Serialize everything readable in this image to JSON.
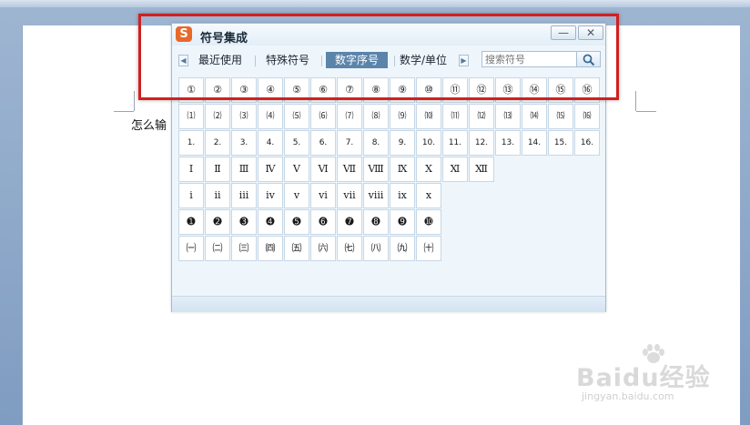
{
  "document": {
    "body_text": "怎么输"
  },
  "symbol_window": {
    "logo": "S",
    "title": "符号集成",
    "minimize_label": "—",
    "close_label": "✕",
    "tabs": [
      {
        "label": "最近使用"
      },
      {
        "label": "特殊符号"
      },
      {
        "label": "数字序号",
        "active": true
      },
      {
        "label": "数学/单位"
      }
    ],
    "prev_label": "◀",
    "next_label": "▶",
    "search_placeholder": "搜索符号",
    "grid_rows": [
      [
        "①",
        "②",
        "③",
        "④",
        "⑤",
        "⑥",
        "⑦",
        "⑧",
        "⑨",
        "⑩",
        "⑪",
        "⑫",
        "⑬",
        "⑭",
        "⑮",
        "⑯"
      ],
      [
        "⑴",
        "⑵",
        "⑶",
        "⑷",
        "⑸",
        "⑹",
        "⑺",
        "⑻",
        "⑼",
        "⑽",
        "⑾",
        "⑿",
        "⒀",
        "⒁",
        "⒂",
        "⒃"
      ],
      [
        "1.",
        "2.",
        "3.",
        "4.",
        "5.",
        "6.",
        "7.",
        "8.",
        "9.",
        "10.",
        "11.",
        "12.",
        "13.",
        "14.",
        "15.",
        "16."
      ],
      [
        "Ⅰ",
        "Ⅱ",
        "Ⅲ",
        "Ⅳ",
        "Ⅴ",
        "Ⅵ",
        "Ⅶ",
        "Ⅷ",
        "Ⅸ",
        "Ⅹ",
        "Ⅺ",
        "Ⅻ"
      ],
      [
        "ⅰ",
        "ⅱ",
        "ⅲ",
        "ⅳ",
        "ⅴ",
        "ⅵ",
        "ⅶ",
        "ⅷ",
        "ⅸ",
        "ⅹ"
      ],
      [
        "➊",
        "➋",
        "➌",
        "➍",
        "➎",
        "➏",
        "➐",
        "➑",
        "➒",
        "➓"
      ],
      [
        "㈠",
        "㈡",
        "㈢",
        "㈣",
        "㈤",
        "㈥",
        "㈦",
        "㈧",
        "㈨",
        "㈩"
      ]
    ]
  },
  "watermark": {
    "brand": "Baidu经验",
    "url": "jingyan.baidu.com"
  },
  "colors": {
    "active_tab": "#5b84aa",
    "highlight": "#d21f1f",
    "window_bg": "#eef6fc",
    "cell_border": "#c6d7e6"
  }
}
